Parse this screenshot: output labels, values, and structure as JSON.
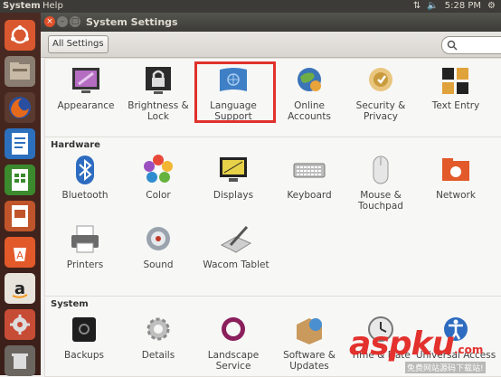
{
  "topbar": {
    "app_name": "System",
    "menu": "Help",
    "clock": "5:28 PM"
  },
  "window": {
    "title": "System Settings",
    "all_settings": "All Settings",
    "search_placeholder": ""
  },
  "personal": {
    "items": [
      {
        "label": "Appearance"
      },
      {
        "label": "Brightness &\nLock"
      },
      {
        "label": "Language\nSupport"
      },
      {
        "label": "Online\nAccounts"
      },
      {
        "label": "Security &\nPrivacy"
      },
      {
        "label": "Text Entry"
      }
    ]
  },
  "hardware": {
    "heading": "Hardware",
    "items": [
      {
        "label": "Bluetooth"
      },
      {
        "label": "Color"
      },
      {
        "label": "Displays"
      },
      {
        "label": "Keyboard"
      },
      {
        "label": "Mouse &\nTouchpad"
      },
      {
        "label": "Network"
      },
      {
        "label": "Printers"
      },
      {
        "label": "Sound"
      },
      {
        "label": "Wacom Tablet"
      }
    ]
  },
  "system": {
    "heading": "System",
    "items": [
      {
        "label": "Backups"
      },
      {
        "label": "Details"
      },
      {
        "label": "Landscape\nService"
      },
      {
        "label": "Software &\nUpdates"
      },
      {
        "label": "Time & Date"
      },
      {
        "label": "Universal Access"
      }
    ]
  },
  "watermark": {
    "brand": "aspku",
    "tld": ".com",
    "tagline": "免费网站源码下载站!"
  },
  "colors": {
    "highlight": "#e0312b",
    "launcher": "#4a2a22",
    "panel": "#3c3b37"
  }
}
